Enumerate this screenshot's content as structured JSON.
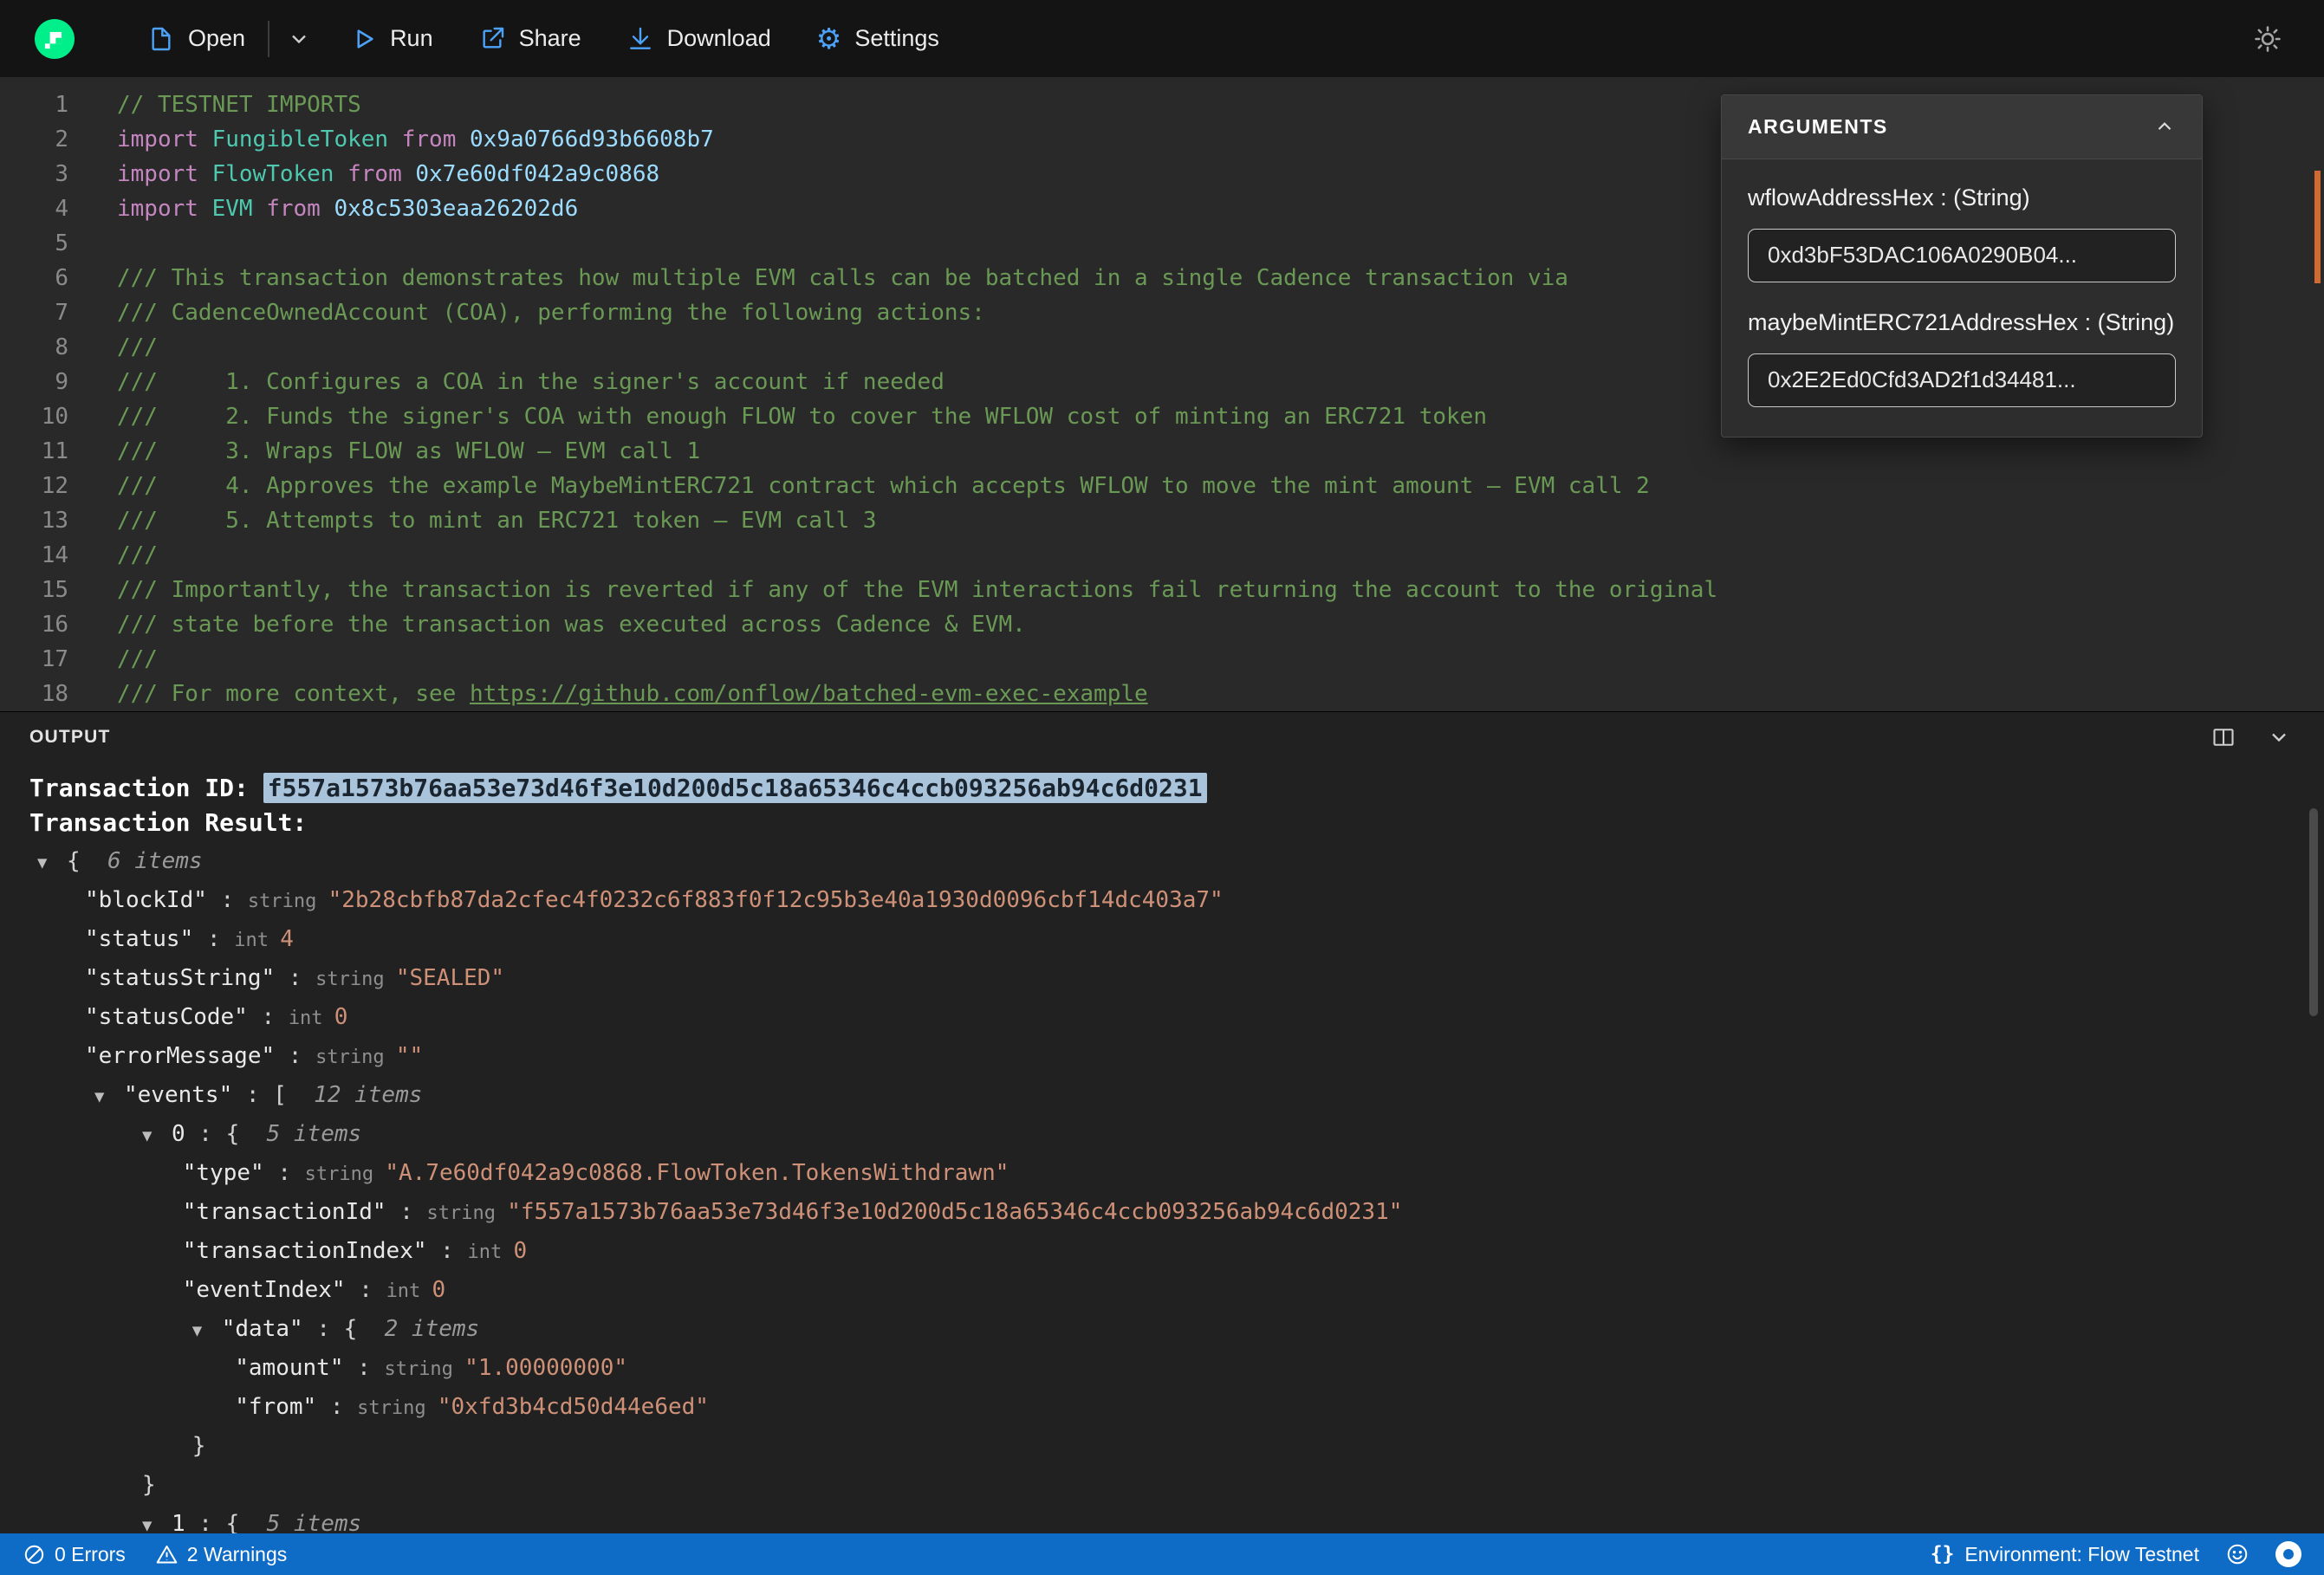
{
  "colors": {
    "logo_green": "#00ef8b",
    "accent_icon_blue": "#4da2f8",
    "status_bar_blue": "#0f6cc6",
    "comment_green": "#6a9955",
    "string_orange": "#ce9178",
    "selection_highlight": "#a9c4da"
  },
  "toolbar": {
    "open": "Open",
    "run": "Run",
    "share": "Share",
    "download": "Download",
    "settings": "Settings"
  },
  "editor": {
    "lines": [
      {
        "n": "1",
        "s": [
          [
            "// TESTNET IMPORTS",
            "cmt"
          ]
        ]
      },
      {
        "n": "2",
        "s": [
          [
            "import ",
            "kw"
          ],
          [
            "FungibleToken",
            "type"
          ],
          [
            " from ",
            "kw"
          ],
          [
            "0x9a0766d93b6608b7",
            "addr"
          ]
        ]
      },
      {
        "n": "3",
        "s": [
          [
            "import ",
            "kw"
          ],
          [
            "FlowToken",
            "type"
          ],
          [
            " from ",
            "kw"
          ],
          [
            "0x7e60df042a9c0868",
            "addr"
          ]
        ]
      },
      {
        "n": "4",
        "s": [
          [
            "import ",
            "kw"
          ],
          [
            "EVM",
            "type"
          ],
          [
            " from ",
            "kw"
          ],
          [
            "0x8c5303eaa26202d6",
            "addr"
          ]
        ]
      },
      {
        "n": "5",
        "s": []
      },
      {
        "n": "6",
        "s": [
          [
            "/// This transaction demonstrates how multiple EVM calls can be batched in a single Cadence transaction via",
            "cmt"
          ]
        ]
      },
      {
        "n": "7",
        "s": [
          [
            "/// CadenceOwnedAccount (COA), performing the following actions:",
            "cmt"
          ]
        ]
      },
      {
        "n": "8",
        "s": [
          [
            "///",
            "cmt"
          ]
        ]
      },
      {
        "n": "9",
        "s": [
          [
            "///     1. Configures a COA in the signer's account if needed",
            "cmt"
          ]
        ]
      },
      {
        "n": "10",
        "s": [
          [
            "///     2. Funds the signer's COA with enough FLOW to cover the WFLOW cost of minting an ERC721 token",
            "cmt"
          ]
        ]
      },
      {
        "n": "11",
        "s": [
          [
            "///     3. Wraps FLOW as WFLOW – EVM call 1",
            "cmt"
          ]
        ]
      },
      {
        "n": "12",
        "s": [
          [
            "///     4. Approves the example MaybeMintERC721 contract which accepts WFLOW to move the mint amount – EVM call 2",
            "cmt"
          ]
        ]
      },
      {
        "n": "13",
        "s": [
          [
            "///     5. Attempts to mint an ERC721 token – EVM call 3",
            "cmt"
          ]
        ]
      },
      {
        "n": "14",
        "s": [
          [
            "///",
            "cmt"
          ]
        ]
      },
      {
        "n": "15",
        "s": [
          [
            "/// Importantly, the transaction is reverted if any of the EVM interactions fail returning the account to the original",
            "cmt"
          ]
        ]
      },
      {
        "n": "16",
        "s": [
          [
            "/// state before the transaction was executed across Cadence & EVM.",
            "cmt"
          ]
        ]
      },
      {
        "n": "17",
        "s": [
          [
            "///",
            "cmt"
          ]
        ]
      },
      {
        "n": "18",
        "s": [
          [
            "/// For more context, see ",
            "cmt"
          ],
          [
            "https://github.com/onflow/batched-evm-exec-example",
            "link"
          ]
        ]
      }
    ]
  },
  "arguments_panel": {
    "title": "ARGUMENTS",
    "fields": [
      {
        "label": "wflowAddressHex : (String)",
        "value": "0xd3bF53DAC106A0290B04..."
      },
      {
        "label": "maybeMintERC721AddressHex : (String)",
        "value": "0x2E2Ed0Cfd3AD2f1d34481..."
      }
    ]
  },
  "output": {
    "title": "OUTPUT",
    "txn_id_label": "Transaction ID: ",
    "txn_id_value": "f557a1573b76aa53e73d46f3e10d200d5c18a65346c4ccb093256ab94c6d0231",
    "txn_result_label": "Transaction Result:",
    "tree": [
      {
        "ind": 0,
        "s": [
          [
            "▼",
            "arrow"
          ],
          [
            "{",
            "brace"
          ],
          [
            "  6 items",
            "items"
          ]
        ]
      },
      {
        "ind": 1,
        "s": [
          [
            "\"blockId\"",
            "key"
          ],
          [
            " : ",
            "colon"
          ],
          [
            "string ",
            "typ"
          ],
          [
            "\"2b28cbfb87da2cfec4f0232c6f883f0f12c95b3e40a1930d0096cbf14dc403a7\"",
            "str"
          ]
        ]
      },
      {
        "ind": 1,
        "s": [
          [
            "\"status\"",
            "key"
          ],
          [
            " : ",
            "colon"
          ],
          [
            "int ",
            "typ"
          ],
          [
            "4",
            "num"
          ]
        ]
      },
      {
        "ind": 1,
        "s": [
          [
            "\"statusString\"",
            "key"
          ],
          [
            " : ",
            "colon"
          ],
          [
            "string ",
            "typ"
          ],
          [
            "\"SEALED\"",
            "str"
          ]
        ]
      },
      {
        "ind": 1,
        "s": [
          [
            "\"statusCode\"",
            "key"
          ],
          [
            " : ",
            "colon"
          ],
          [
            "int ",
            "typ"
          ],
          [
            "0",
            "num"
          ]
        ]
      },
      {
        "ind": 1,
        "s": [
          [
            "\"errorMessage\"",
            "key"
          ],
          [
            " : ",
            "colon"
          ],
          [
            "string ",
            "typ"
          ],
          [
            "\"\"",
            "str"
          ]
        ]
      },
      {
        "ind": 1.2,
        "s": [
          [
            "▼",
            "arrow"
          ],
          [
            "\"events\"",
            "key"
          ],
          [
            " : ",
            "colon"
          ],
          [
            "[",
            "brace"
          ],
          [
            "  12 items",
            "items"
          ]
        ]
      },
      {
        "ind": 2.2,
        "s": [
          [
            "▼",
            "arrow"
          ],
          [
            "0",
            "key"
          ],
          [
            " : ",
            "colon"
          ],
          [
            "{",
            "brace"
          ],
          [
            "  5 items",
            "items"
          ]
        ]
      },
      {
        "ind": 3.05,
        "s": [
          [
            "\"type\"",
            "key"
          ],
          [
            " : ",
            "colon"
          ],
          [
            "string ",
            "typ"
          ],
          [
            "\"A.7e60df042a9c0868.FlowToken.TokensWithdrawn\"",
            "str"
          ]
        ]
      },
      {
        "ind": 3.05,
        "s": [
          [
            "\"transactionId\"",
            "key"
          ],
          [
            " : ",
            "colon"
          ],
          [
            "string ",
            "typ"
          ],
          [
            "\"f557a1573b76aa53e73d46f3e10d200d5c18a65346c4ccb093256ab94c6d0231\"",
            "str"
          ]
        ]
      },
      {
        "ind": 3.05,
        "s": [
          [
            "\"transactionIndex\"",
            "key"
          ],
          [
            " : ",
            "colon"
          ],
          [
            "int ",
            "typ"
          ],
          [
            "0",
            "num"
          ]
        ]
      },
      {
        "ind": 3.05,
        "s": [
          [
            "\"eventIndex\"",
            "key"
          ],
          [
            " : ",
            "colon"
          ],
          [
            "int ",
            "typ"
          ],
          [
            "0",
            "num"
          ]
        ]
      },
      {
        "ind": 3.25,
        "s": [
          [
            "▼",
            "arrow"
          ],
          [
            "\"data\"",
            "key"
          ],
          [
            " : ",
            "colon"
          ],
          [
            "{",
            "brace"
          ],
          [
            "  2 items",
            "items"
          ]
        ]
      },
      {
        "ind": 4.15,
        "s": [
          [
            "\"amount\"",
            "key"
          ],
          [
            " : ",
            "colon"
          ],
          [
            "string ",
            "typ"
          ],
          [
            "\"1.00000000\"",
            "str"
          ]
        ]
      },
      {
        "ind": 4.15,
        "s": [
          [
            "\"from\"",
            "key"
          ],
          [
            " : ",
            "colon"
          ],
          [
            "string ",
            "typ"
          ],
          [
            "\"0xfd3b4cd50d44e6ed\"",
            "str"
          ]
        ]
      },
      {
        "ind": 3.25,
        "s": [
          [
            "}",
            "brace"
          ]
        ]
      },
      {
        "ind": 2.2,
        "s": [
          [
            "}",
            "brace"
          ]
        ]
      },
      {
        "ind": 2.2,
        "s": [
          [
            "▼",
            "arrow"
          ],
          [
            "1",
            "key"
          ],
          [
            " : ",
            "colon"
          ],
          [
            "{",
            "brace"
          ],
          [
            "  5 items",
            "items"
          ]
        ]
      }
    ]
  },
  "statusbar": {
    "errors": "0 Errors",
    "warnings": "2 Warnings",
    "braces": "{}",
    "environment": "Environment: Flow Testnet"
  }
}
